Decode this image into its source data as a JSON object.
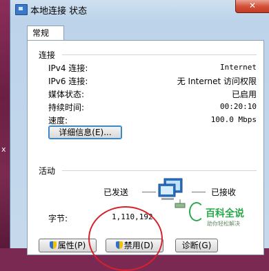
{
  "window": {
    "title": "本地连接 状态",
    "close_glyph": "✕"
  },
  "tabs": [
    {
      "label": "常规"
    }
  ],
  "connection": {
    "group_title": "连接",
    "rows": [
      {
        "label": "IPv4 连接:",
        "value": "Internet"
      },
      {
        "label": "IPv6 连接:",
        "value": "无 Internet 访问权限"
      },
      {
        "label": "媒体状态:",
        "value": "已启用"
      },
      {
        "label": "持续时间:",
        "value": "00:20:10"
      },
      {
        "label": "速度:",
        "value": "100.0 Mbps"
      }
    ],
    "details_button": "详细信息(E)..."
  },
  "activity": {
    "group_title": "活动",
    "sent_label": "已发送",
    "received_label": "已接收",
    "bytes_label": "字节:",
    "bytes_sent": "1,110,192",
    "bytes_received": ""
  },
  "buttons": {
    "properties": "属性(P)",
    "disable": "禁用(D)",
    "diagnose": "诊断(G)"
  },
  "watermark": {
    "main": "百科全说",
    "sub": "助你轻松解决"
  },
  "icons": {
    "title": "network-connection-icon",
    "shield": "uac-shield-icon",
    "activity": "network-computers-icon"
  },
  "colors": {
    "annotation_circle": "#d8202a",
    "watermark": "#2aa84a"
  }
}
